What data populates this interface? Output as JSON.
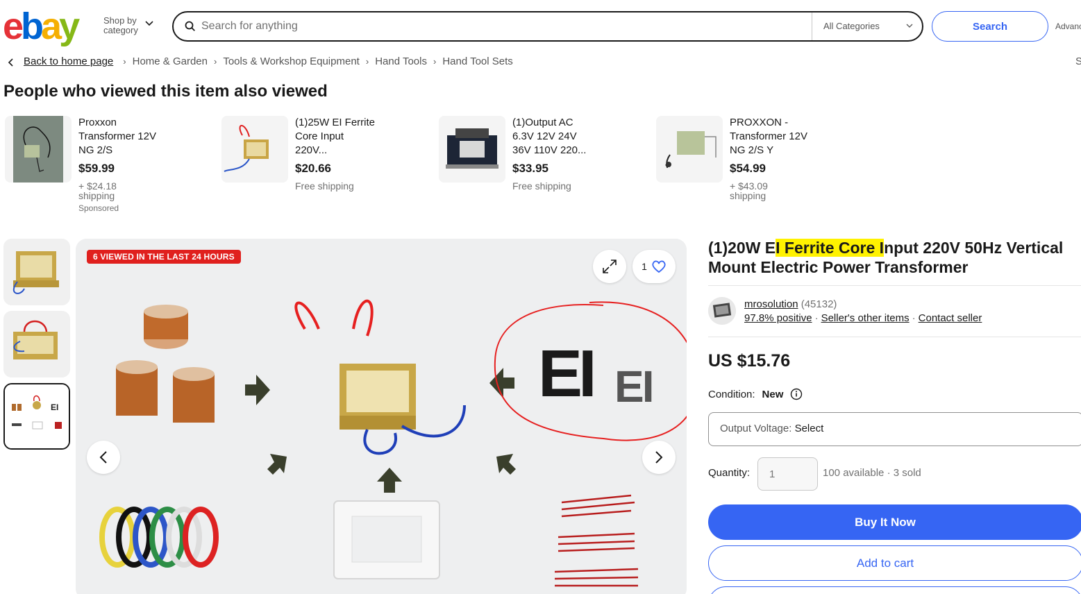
{
  "header": {
    "logo": [
      "e",
      "b",
      "a",
      "y"
    ],
    "shop_by_line1": "Shop by",
    "shop_by_line2": "category",
    "search_placeholder": "Search for anything",
    "category": "All Categories",
    "search_button": "Search",
    "advanced": "Advanced"
  },
  "breadcrumb": {
    "back": "Back to home page",
    "items": [
      "Home & Garden",
      "Tools & Workshop Equipment",
      "Hand Tools",
      "Hand Tool Sets"
    ],
    "right_partial": "S"
  },
  "also_viewed": {
    "title": "People who viewed this item also viewed",
    "items": [
      {
        "title": "Proxxon Transformer 12V NG 2/S",
        "price": "$59.99",
        "shipping_line1": "+ $24.18",
        "shipping_line2": "shipping",
        "sponsored": "Sponsored"
      },
      {
        "title": "(1)25W EI Ferrite Core Input 220V...",
        "price": "$20.66",
        "shipping_line1": "Free shipping",
        "shipping_line2": ""
      },
      {
        "title": "(1)Output AC 6.3V 12V 24V 36V 110V 220...",
        "price": "$33.95",
        "shipping_line1": "Free shipping",
        "shipping_line2": ""
      },
      {
        "title": "PROXXON - Transformer 12V NG 2/S Y",
        "price": "$54.99",
        "shipping_line1": "+ $43.09",
        "shipping_line2": "shipping"
      }
    ]
  },
  "gallery": {
    "badge": "6 VIEWED IN THE LAST 24 HOURS",
    "watch_count": "1",
    "image_text_large": "EI",
    "image_text_small": "EI",
    "thumb_text": "EI"
  },
  "item": {
    "title_pre": "(1)20W E",
    "title_highlight": "I Ferrite Core I",
    "title_post": "nput 220V 50Hz Vertical Mount Electric Power Transformer",
    "seller_name": "mrosolution",
    "seller_count": "(45132)",
    "seller_positive": "97.8% positive",
    "seller_other": "Seller's other items",
    "seller_contact": "Contact seller",
    "price": "US $15.76",
    "condition_label": "Condition:",
    "condition_value": "New",
    "variant_label": "Output Voltage: ",
    "variant_value": "Select",
    "quantity_label": "Quantity:",
    "quantity_value": "1",
    "availability": "100 available",
    "sold": "3 sold",
    "buy_now": "Buy It Now",
    "add_to_cart": "Add to cart"
  },
  "colors": {
    "accent": "#3665f3",
    "badge": "#e0201e",
    "highlight": "#fff200"
  }
}
